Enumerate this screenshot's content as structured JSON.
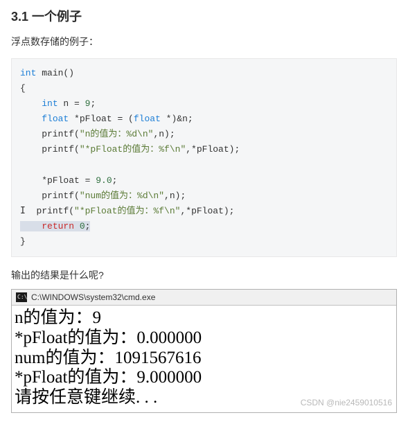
{
  "section": {
    "title": "3.1 一个例子",
    "intro": "浮点数存储的例子：",
    "question": "输出的结果是什么呢?"
  },
  "code": {
    "kw_int": "int",
    "fn_main": "main()",
    "brace_open": "{",
    "decl_n_pre": "    ",
    "decl_n_var": " n = ",
    "decl_n_val": "9",
    "semi": ";",
    "decl_f_pre": "    ",
    "kw_float": "float",
    "decl_f_var": " *pFloat = (",
    "decl_f_cast": " *)&n;",
    "p1_pre": "    printf(",
    "p1_str": "\"n的值为：%d\\n\"",
    "p1_args": ",n);",
    "p2_pre": "    printf(",
    "p2_str": "\"*pFloat的值为：%f\\n\"",
    "p2_args": ",*pFloat);",
    "assign_pre": "    *pFloat = ",
    "assign_val": "9.0",
    "p3_pre": "    printf(",
    "p3_str": "\"num的值为：%d\\n\"",
    "p3_args": ",n);",
    "p4_pre": "    printf(",
    "p4_str": "\"*pFloat的值为：%f\\n\"",
    "p4_args": ",*pFloat);",
    "ret_pre": "    ",
    "kw_return": "return",
    "ret_val": " 0",
    "brace_close": "}",
    "caret": "I"
  },
  "cmd": {
    "title_path": "C:\\WINDOWS\\system32\\cmd.exe",
    "line1": "n的值为：9",
    "line2": "*pFloat的值为：0.000000",
    "line3": "num的值为：1091567616",
    "line4": "*pFloat的值为：9.000000",
    "line5": "请按任意键继续. . ."
  },
  "watermark": "CSDN @nie2459010516"
}
